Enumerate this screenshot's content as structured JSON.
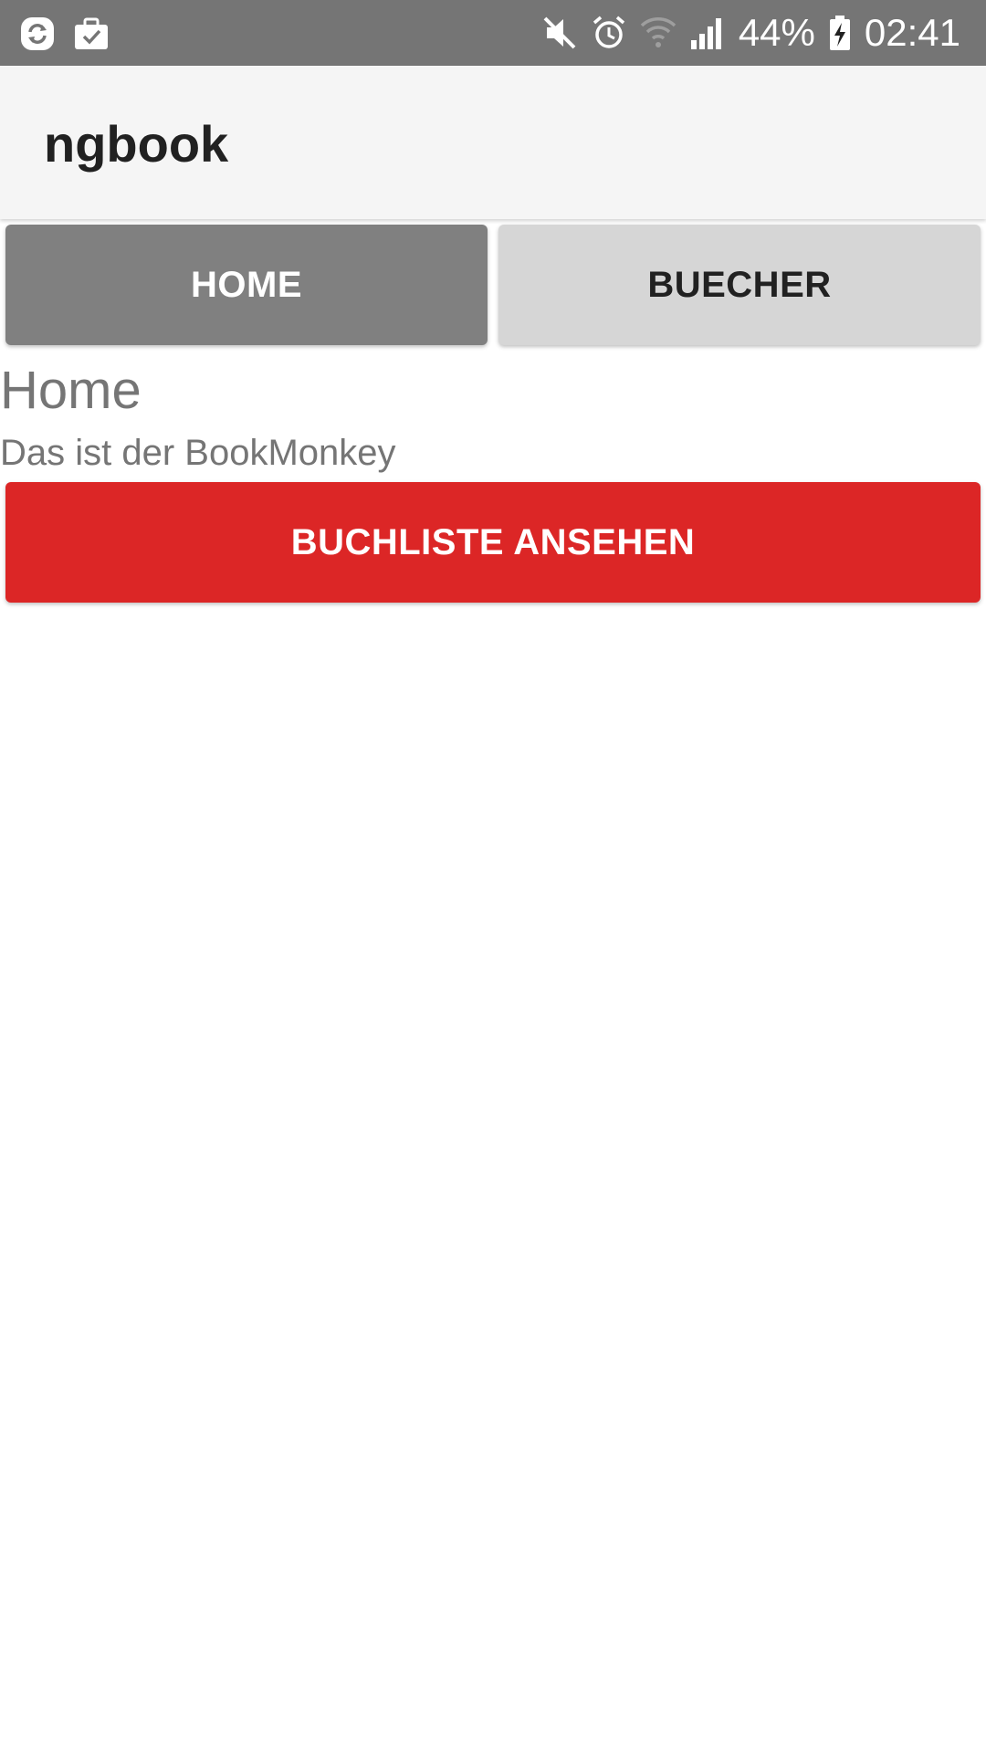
{
  "status_bar": {
    "left_icons": [
      "sync-icon",
      "briefcase-check-icon"
    ],
    "right_icons": [
      "mute-icon",
      "alarm-icon",
      "wifi-icon",
      "signal-icon"
    ],
    "battery_percent": "44%",
    "battery_icon": "battery-charging-icon",
    "time": "02:41"
  },
  "app_bar": {
    "title": "ngbook"
  },
  "tabs": [
    {
      "label": "HOME",
      "active": true
    },
    {
      "label": "BUECHER",
      "active": false
    }
  ],
  "main": {
    "heading": "Home",
    "subtitle": "Das ist der BookMonkey",
    "cta_label": "BUCHLISTE ANSEHEN"
  },
  "colors": {
    "status_bar_bg": "#757575",
    "app_bar_bg": "#f5f5f5",
    "tab_active_bg": "#808080",
    "tab_inactive_bg": "#d6d6d6",
    "cta_bg": "#dc2626",
    "text_muted": "#757575"
  }
}
